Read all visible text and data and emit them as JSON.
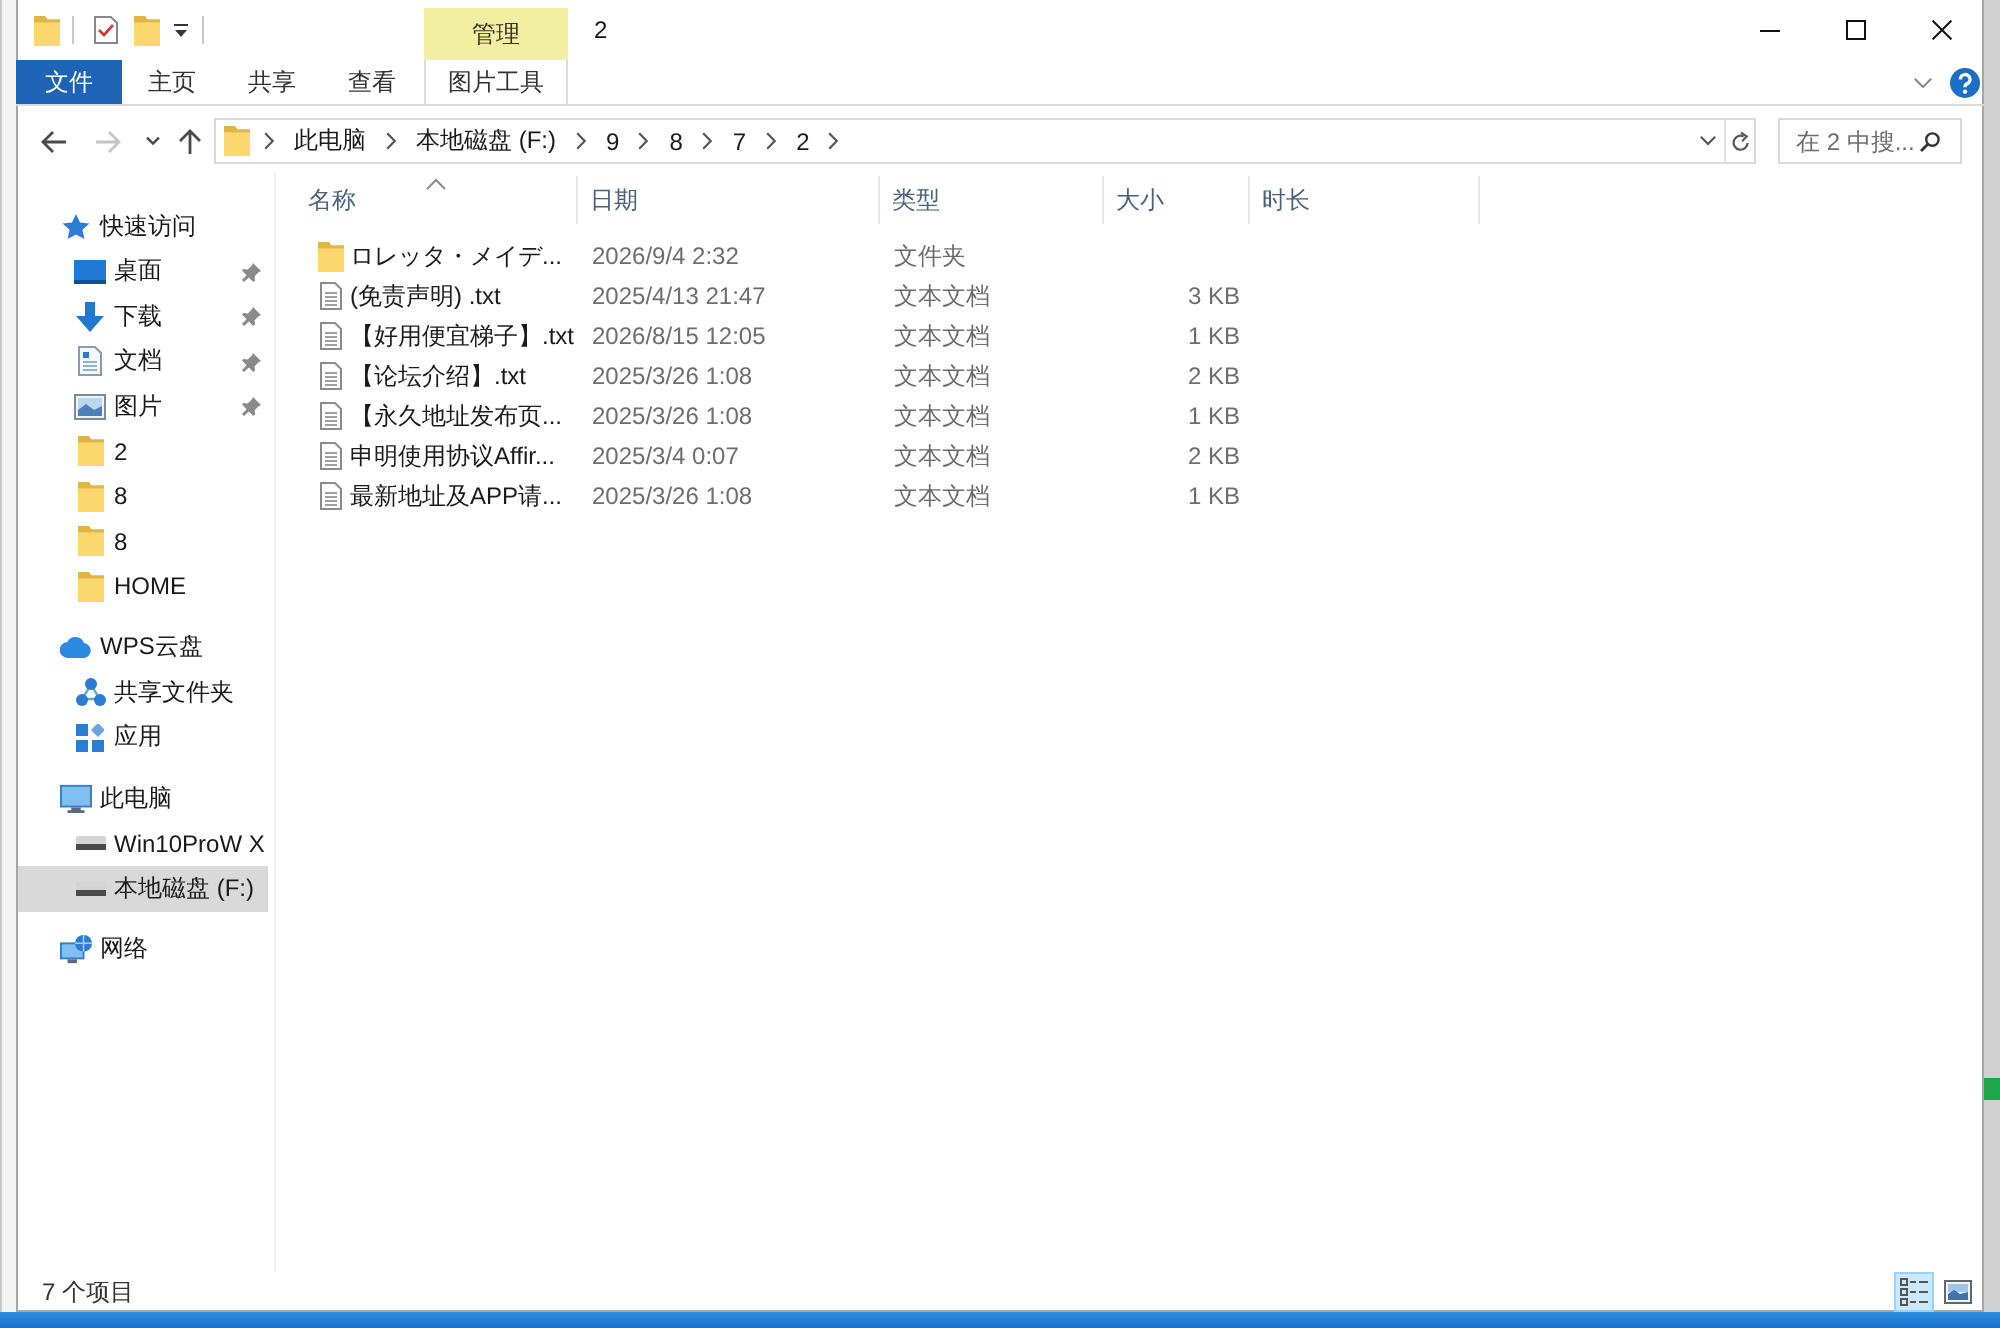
{
  "title_bar": {
    "contextual_header": "管理",
    "title": "2"
  },
  "ribbon": {
    "tabs": [
      {
        "label": "文件",
        "kind": "file"
      },
      {
        "label": "主页",
        "kind": "plain"
      },
      {
        "label": "共享",
        "kind": "plain"
      },
      {
        "label": "查看",
        "kind": "plain"
      },
      {
        "label": "图片工具",
        "kind": "contextual"
      }
    ]
  },
  "nav_buttons": [
    {
      "kind": "back",
      "disabled": false
    },
    {
      "kind": "forward",
      "disabled": true
    },
    {
      "kind": "recent",
      "disabled": false
    },
    {
      "kind": "up",
      "disabled": false
    }
  ],
  "address_bar": {
    "crumbs": [
      "此电脑",
      "本地磁盘 (F:)",
      "9",
      "8",
      "7",
      "2"
    ]
  },
  "search": {
    "placeholder": "在 2 中搜..."
  },
  "nav_pane": {
    "items": [
      {
        "label": "快速访问",
        "kind": "star",
        "selected": false,
        "children": [
          {
            "label": "桌面",
            "kind": "desktop",
            "pinned": true,
            "selected": false
          },
          {
            "label": "下载",
            "kind": "download",
            "pinned": true,
            "selected": false
          },
          {
            "label": "文档",
            "kind": "documents",
            "pinned": true,
            "selected": false
          },
          {
            "label": "图片",
            "kind": "pictures",
            "pinned": true,
            "selected": false
          },
          {
            "label": "2",
            "kind": "folder",
            "pinned": false,
            "selected": false
          },
          {
            "label": "8",
            "kind": "folder",
            "pinned": false,
            "selected": false
          },
          {
            "label": "8",
            "kind": "folder",
            "pinned": false,
            "selected": false
          },
          {
            "label": "HOME",
            "kind": "folder",
            "pinned": false,
            "selected": false
          }
        ]
      },
      {
        "label": "WPS云盘",
        "kind": "cloud",
        "selected": false,
        "children": [
          {
            "label": "共享文件夹",
            "kind": "share",
            "selected": false
          },
          {
            "label": "应用",
            "kind": "apps",
            "selected": false
          }
        ]
      },
      {
        "label": "此电脑",
        "kind": "pc",
        "selected": false,
        "children": [
          {
            "label": "Win10ProW X",
            "kind": "drive",
            "selected": false
          },
          {
            "label": "本地磁盘 (F:)",
            "kind": "drive",
            "selected": true
          }
        ]
      },
      {
        "label": "网络",
        "kind": "network",
        "selected": false
      }
    ]
  },
  "columns": [
    {
      "label": "名称",
      "sorted": true
    },
    {
      "label": "日期",
      "sorted": false
    },
    {
      "label": "类型",
      "sorted": false
    },
    {
      "label": "大小",
      "sorted": false
    },
    {
      "label": "时长",
      "sorted": false
    }
  ],
  "files": [
    {
      "name": "ロレッタ・メイデ...",
      "kind": "folder",
      "date": "2026/9/4 2:32",
      "type": "文件夹",
      "selected": false
    },
    {
      "name": "(免责声明) .txt",
      "kind": "text",
      "date": "2025/4/13 21:47",
      "type": "文本文档",
      "size": "3 KB",
      "selected": false
    },
    {
      "name": "【好用便宜梯子】.txt",
      "kind": "text",
      "date": "2026/8/15 12:05",
      "type": "文本文档",
      "size": "1 KB",
      "selected": false
    },
    {
      "name": "【论坛介绍】.txt",
      "kind": "text",
      "date": "2025/3/26 1:08",
      "type": "文本文档",
      "size": "2 KB",
      "selected": false
    },
    {
      "name": "【永久地址发布页...",
      "kind": "text",
      "date": "2025/3/26 1:08",
      "type": "文本文档",
      "size": "1 KB",
      "selected": false
    },
    {
      "name": "申明使用协议Affir...",
      "kind": "text",
      "date": "2025/3/4 0:07",
      "type": "文本文档",
      "size": "2 KB",
      "selected": false
    },
    {
      "name": "最新地址及APP请...",
      "kind": "text",
      "date": "2025/3/26 1:08",
      "type": "文本文档",
      "size": "1 KB",
      "selected": false
    }
  ],
  "status_bar": {
    "count": "7 个项目",
    "views": [
      {
        "kind": "details",
        "selected": true
      },
      {
        "kind": "tiles",
        "selected": false
      }
    ]
  }
}
